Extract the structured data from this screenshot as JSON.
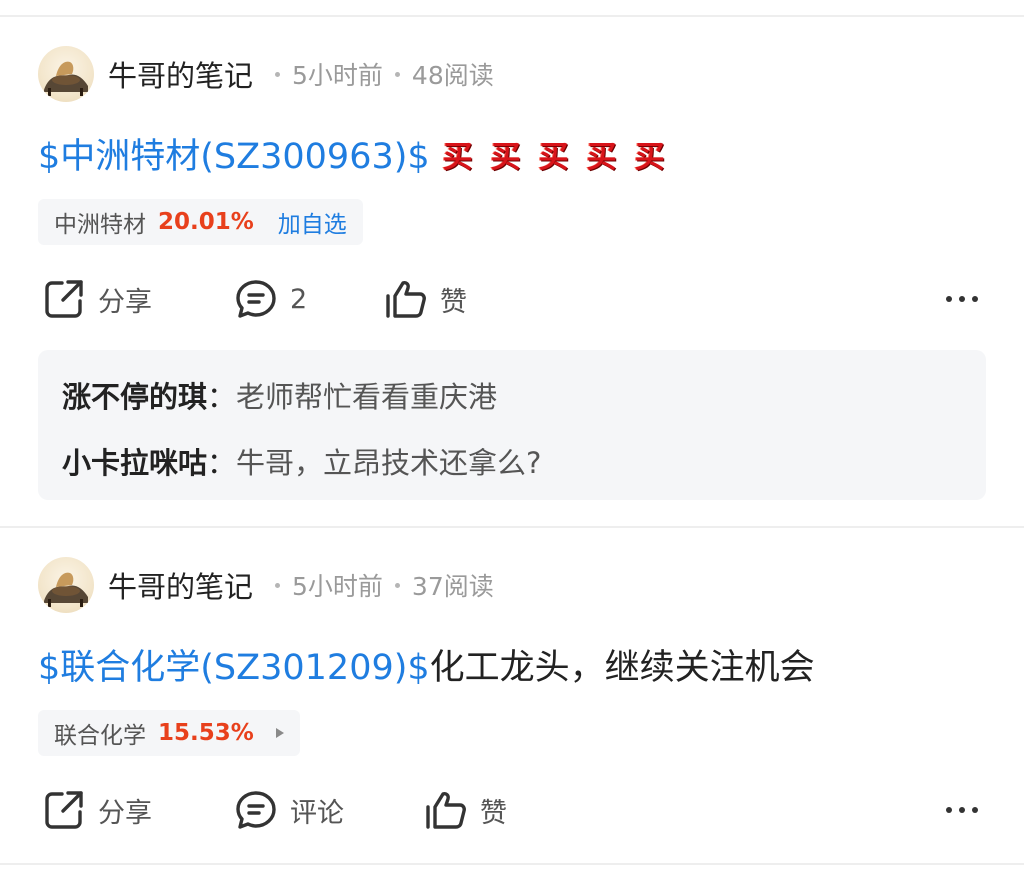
{
  "posts": [
    {
      "author": "牛哥的笔记",
      "time": "5小时前",
      "reads": "48阅读",
      "stock_link": "$中洲特材(SZ300963)$",
      "text": "",
      "emoji_label": "买",
      "emoji_count": 5,
      "chip": {
        "name": "中洲特材",
        "pct": "20.01%",
        "action": "加自选"
      },
      "actions": {
        "share": "分享",
        "comment": "2",
        "like": "赞"
      },
      "comments": [
        {
          "user": "涨不停的琪",
          "sep": "：",
          "text": "老师帮忙看看重庆港"
        },
        {
          "user": "小卡拉咪咕",
          "sep": "：",
          "text": "牛哥，立昂技术还拿么?"
        }
      ]
    },
    {
      "author": "牛哥的笔记",
      "time": "5小时前",
      "reads": "37阅读",
      "stock_link": "$联合化学(SZ301209)$",
      "text": "化工龙头，继续关注机会",
      "chip": {
        "name": "联合化学",
        "pct": "15.53%"
      },
      "actions": {
        "share": "分享",
        "comment": "评论",
        "like": "赞"
      }
    }
  ],
  "icons": {
    "share": "share-icon",
    "comment": "comment-bubble-icon",
    "like": "thumbs-up-icon",
    "more": "more-horizontal-icon",
    "chip_arrow": "triangle-right-icon"
  },
  "colors": {
    "link": "#1f7de0",
    "rise": "#e8401c",
    "emoji_red": "#d8141a",
    "panel_bg": "#f5f6f8"
  }
}
